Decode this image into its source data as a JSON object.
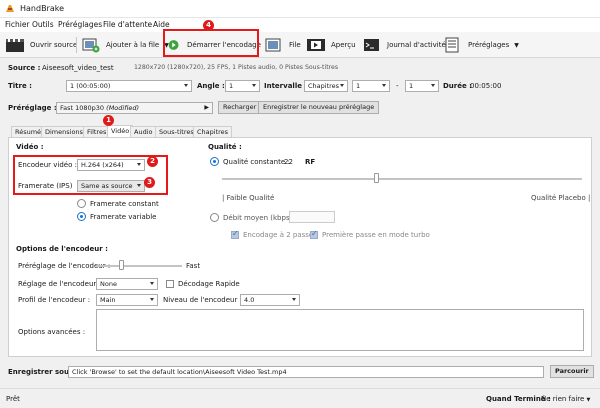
{
  "window": {
    "title": "HandBrake"
  },
  "menu": [
    "Fichier",
    "Outils",
    "Préréglages",
    "File d'attente",
    "Aide"
  ],
  "toolbar": {
    "open_source": "Ouvrir source",
    "add_to_queue": "Ajouter à la file",
    "start": "Démarrer l'encodage",
    "queue": "File",
    "preview": "Aperçu",
    "activity": "Journal d'activité",
    "presets": "Préréglages"
  },
  "source": {
    "label": "Source :",
    "name": "Aiseesoft_video_test",
    "info": "1280x720 (1280x720), 25 FPS, 1 Pistes audio, 0 Pistes Sous-titres"
  },
  "title_row": {
    "title_label": "Titre :",
    "title_value": "1 (00:05:00)",
    "angle_label": "Angle :",
    "angle_value": "1",
    "range_label": "Intervalle :",
    "range_type": "Chapitres",
    "range_start": "1",
    "range_dash": "-",
    "range_end": "1",
    "duration_label": "Durée :",
    "duration_value": "00:05:00"
  },
  "preset_row": {
    "label": "Préréglage :",
    "value": "Fast 1080p30",
    "modified": "(Modified)",
    "reload": "Recharger",
    "save_new": "Enregistrer le nouveau préréglage"
  },
  "tabs": [
    "Résumé",
    "Dimensions",
    "Filtres",
    "Vidéo",
    "Audio",
    "Sous-titres",
    "Chapitres"
  ],
  "video": {
    "heading": "Vidéo :",
    "encoder_label": "Encodeur vidéo :",
    "encoder_value": "H.264 (x264)",
    "framerate_label": "Framerate (IPS)",
    "framerate_value": "Same as source",
    "constant_fr": "Framerate constant",
    "variable_fr": "Framerate variable"
  },
  "quality": {
    "heading": "Qualité :",
    "constant_label": "Qualité constante :",
    "constant_value": "22",
    "rf_label": "RF",
    "slider_level": 0.43,
    "low_label": "| Faible Qualité",
    "high_label": "Qualité Placebo |",
    "avg_bitrate_label": "Débit moyen (kbps) :",
    "two_pass": "Encodage à 2 passes",
    "turbo": "Première passe en mode turbo"
  },
  "encoder_options": {
    "heading": "Options de l'encodeur :",
    "preset_label": "Préréglage de l'encodeur :",
    "preset_right": "Fast",
    "preset_level": 0.3,
    "tune_label": "Réglage de l'encodeur :",
    "tune_value": "None",
    "fast_decode": "Décodage Rapide",
    "profile_label": "Profil de l'encodeur :",
    "profile_value": "Main",
    "level_label": "Niveau de l'encodeur :",
    "level_value": "4.0",
    "advanced_label": "Options avancées :"
  },
  "save": {
    "label": "Enregistrer sous :",
    "path": "Click 'Browse' to set the default location\\Aiseesoft Video Test.mp4",
    "browse": "Parcourir"
  },
  "status": {
    "left": "Prêt",
    "done_label": "Quand Terminé :",
    "done_value": "Ne rien faire"
  },
  "badges": [
    "1",
    "2",
    "3",
    "4"
  ],
  "colors": {
    "highlight": "#e51919",
    "accent": "#1a73c8",
    "play": "#3aa43a"
  }
}
